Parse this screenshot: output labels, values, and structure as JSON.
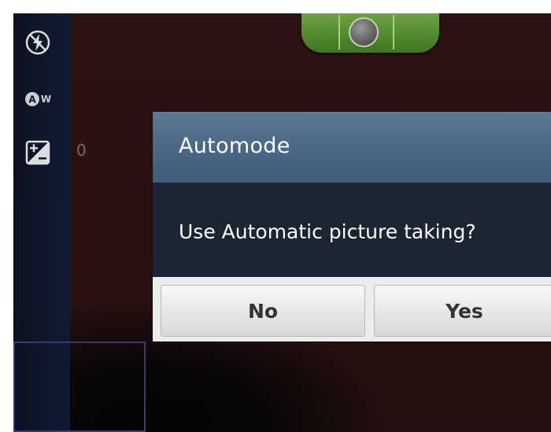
{
  "dialog": {
    "title": "Automode",
    "message": "Use Automatic picture taking?",
    "buttons": {
      "no": "No",
      "yes": "Yes"
    }
  },
  "camera_settings": {
    "flash_icon": "flash-off-icon",
    "white_balance_icon": "auto-white-balance-icon",
    "white_balance_badge": "W",
    "exposure_icon": "exposure-compensation-icon",
    "exposure_value": "0"
  },
  "colors": {
    "dialog_title_bar": "#4b6985",
    "dialog_body": "#1c2632",
    "toggle_green": "#4f8a2c",
    "viewfinder_bg": "#2a1110"
  }
}
